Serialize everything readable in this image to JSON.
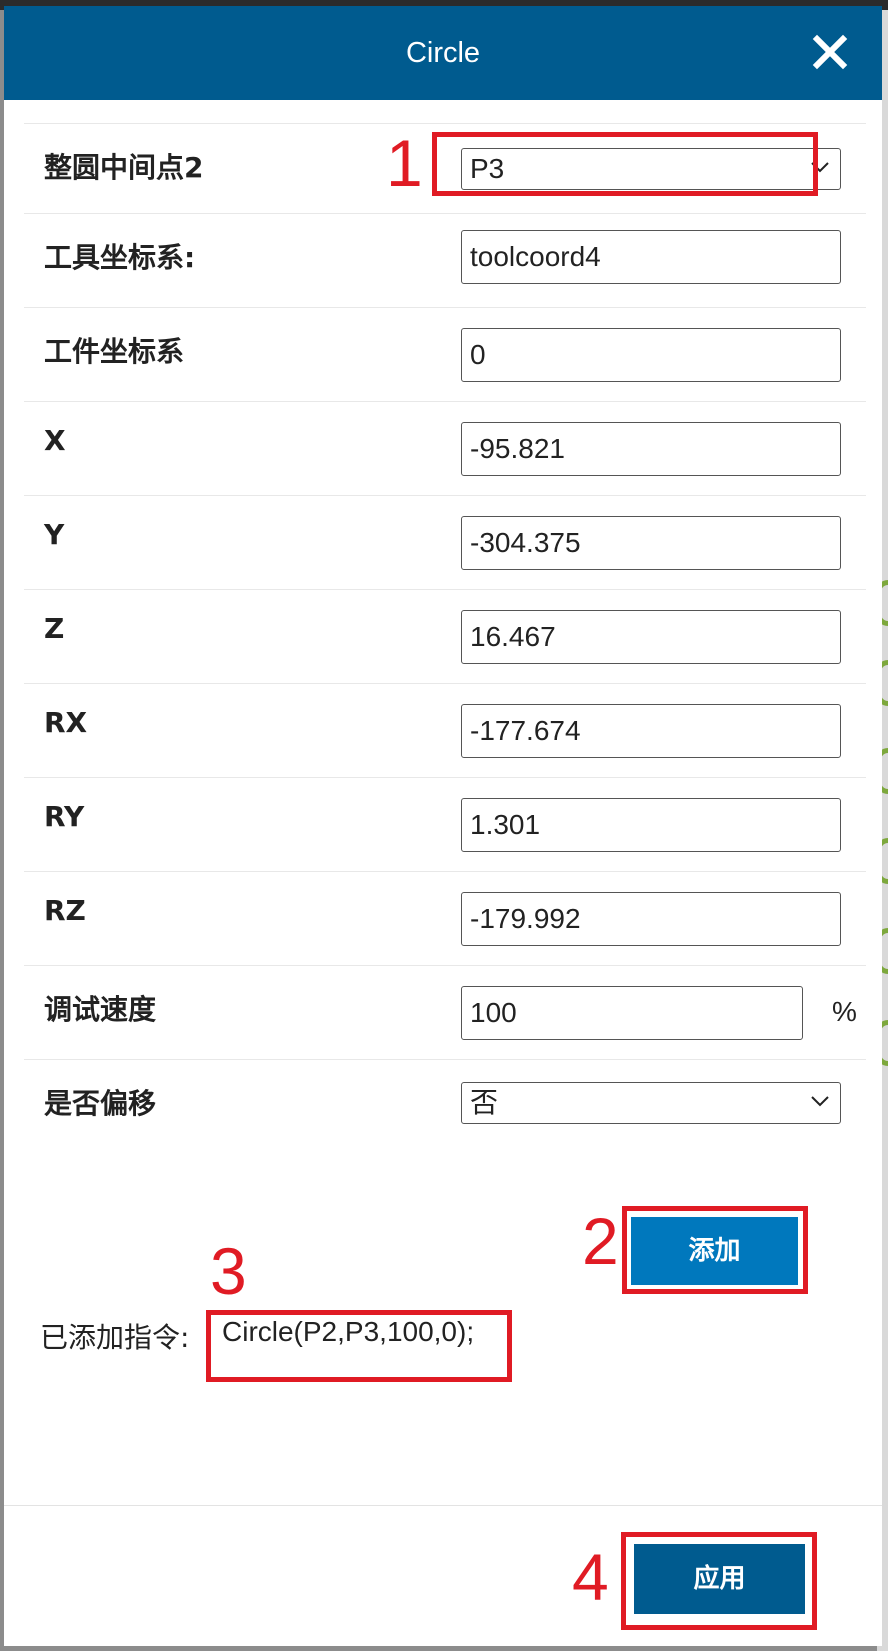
{
  "dialog": {
    "title": "Circle",
    "close_icon": "close-icon"
  },
  "form": {
    "rows": [
      {
        "label": "整圆中间点2",
        "type": "select",
        "value": "P3"
      },
      {
        "label": "工具坐标系:",
        "type": "input",
        "value": "toolcoord4"
      },
      {
        "label": "工件坐标系",
        "type": "input",
        "value": "0"
      },
      {
        "label": "X",
        "type": "input",
        "value": "-95.821"
      },
      {
        "label": "Y",
        "type": "input",
        "value": "-304.375"
      },
      {
        "label": "Z",
        "type": "input",
        "value": "16.467"
      },
      {
        "label": "RX",
        "type": "input",
        "value": "-177.674"
      },
      {
        "label": "RY",
        "type": "input",
        "value": "1.301"
      },
      {
        "label": "RZ",
        "type": "input",
        "value": "-179.992"
      },
      {
        "label": "调试速度",
        "type": "input",
        "value": "100",
        "unit": "%"
      },
      {
        "label": "是否偏移",
        "type": "select",
        "value": "否"
      }
    ]
  },
  "actions": {
    "add_label": "添加",
    "apply_label": "应用"
  },
  "added": {
    "label": "已添加指令:",
    "command": "Circle(P2,P3,100,0);"
  },
  "annotations": [
    "1",
    "2",
    "3",
    "4"
  ],
  "colors": {
    "header": "#005b8f",
    "primary_button": "#0078bd",
    "annotation_red": "#e01b24"
  }
}
